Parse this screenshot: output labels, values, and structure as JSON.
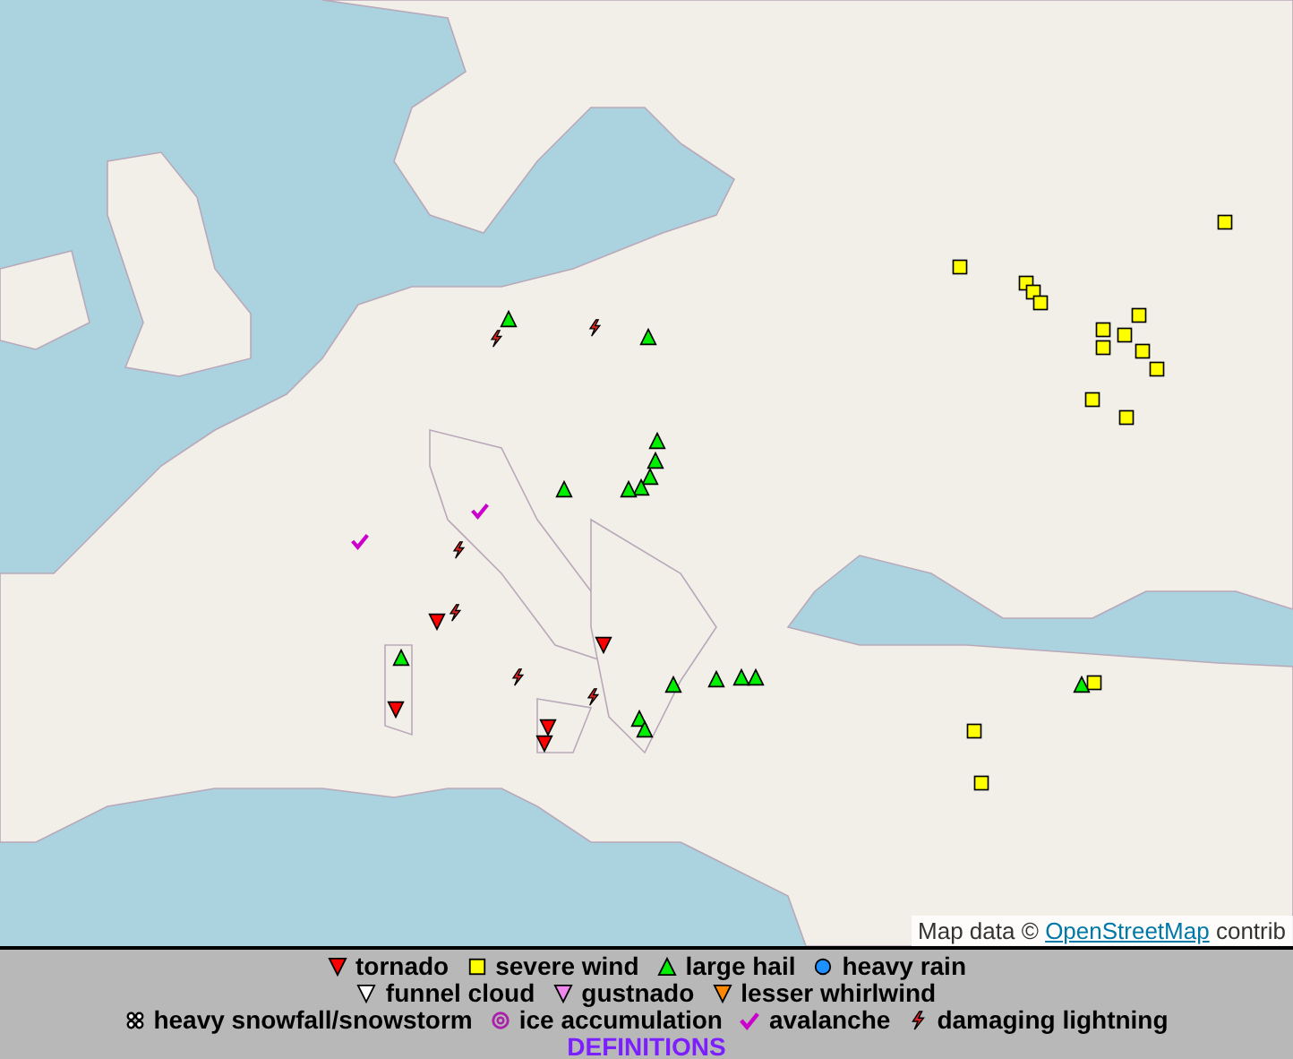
{
  "map": {
    "attribution": {
      "prefix": "Map data ©",
      "link": "OpenStreetMap",
      "suffix": "contrib"
    }
  },
  "legend": {
    "rows": [
      [
        {
          "kind": "tornado",
          "label": "tornado"
        },
        {
          "kind": "wind",
          "label": "severe wind"
        },
        {
          "kind": "hail",
          "label": "large hail"
        },
        {
          "kind": "rain",
          "label": "heavy rain"
        }
      ],
      [
        {
          "kind": "funnel",
          "label": "funnel cloud"
        },
        {
          "kind": "gustnado",
          "label": "gustnado"
        },
        {
          "kind": "whirlwind",
          "label": "lesser whirlwind"
        }
      ],
      [
        {
          "kind": "snow",
          "label": "heavy snowfall/snowstorm"
        },
        {
          "kind": "ice",
          "label": "ice accumulation"
        },
        {
          "kind": "avalanche",
          "label": "avalanche"
        },
        {
          "kind": "lightning",
          "label": "damaging lightning"
        }
      ]
    ],
    "link": "DEFINITIONS"
  }
}
